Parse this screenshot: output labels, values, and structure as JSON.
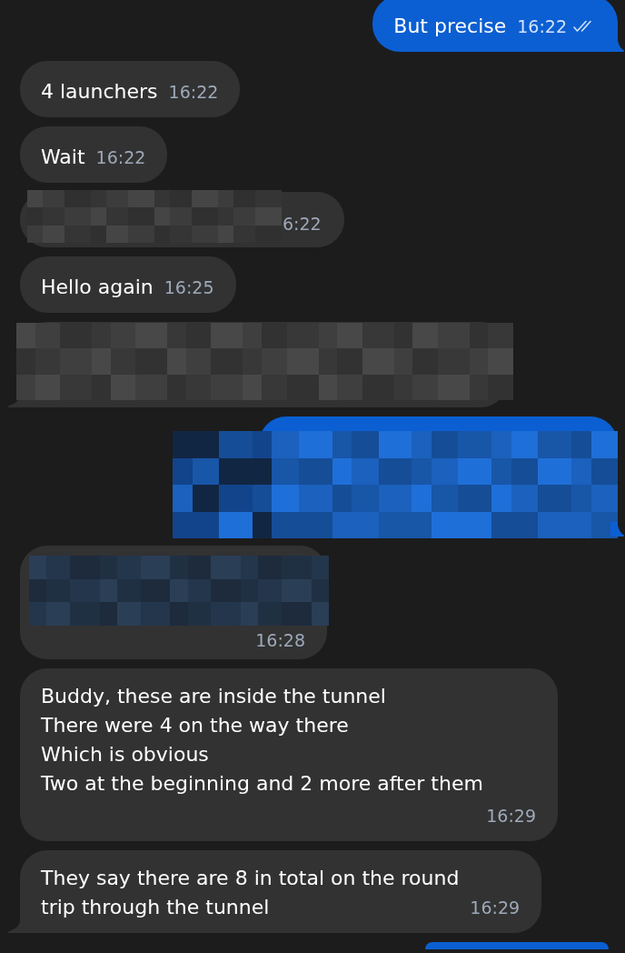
{
  "messages": [
    {
      "outgoing": true,
      "kind": "text",
      "text": "But precise",
      "time": "16:22",
      "read": true,
      "tail": true
    },
    {
      "outgoing": false,
      "kind": "text",
      "text": "4 launchers",
      "time": "16:22",
      "tail": false
    },
    {
      "outgoing": false,
      "kind": "text",
      "text": "Wait",
      "time": "16:22",
      "tail": false
    },
    {
      "outgoing": false,
      "kind": "redacted",
      "color": "#454545",
      "time": "6:22",
      "tail": false
    },
    {
      "outgoing": false,
      "kind": "text",
      "text": "Hello again",
      "time": "16:25",
      "tail": false
    },
    {
      "outgoing": false,
      "kind": "redacted",
      "color": "#484848",
      "tail": true
    },
    {
      "outgoing": true,
      "kind": "redacted",
      "color": "#1f6fd8",
      "tail": true
    },
    {
      "outgoing": false,
      "kind": "redacted",
      "color": "#2a3e56",
      "time": "16:28",
      "tail": false
    },
    {
      "outgoing": false,
      "kind": "text",
      "text": "Buddy, these are inside the tunnel\nThere were 4 on the way there\nWhich is obvious\nTwo at the beginning and 2 more after them",
      "time": "16:29",
      "tail": false
    },
    {
      "outgoing": false,
      "kind": "text",
      "text": "They say there are 8 in total on the round\ntrip through the tunnel",
      "time": "16:29",
      "tail": true
    },
    {
      "outgoing": true,
      "kind": "clipped"
    }
  ]
}
